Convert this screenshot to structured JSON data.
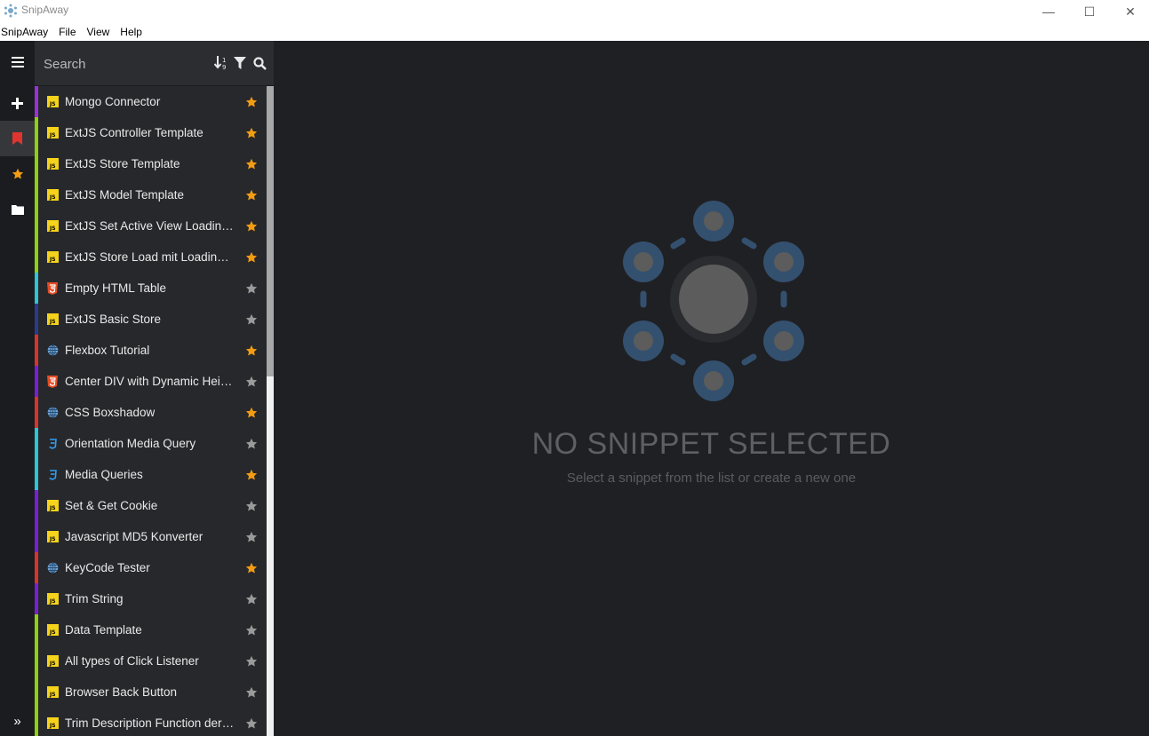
{
  "window": {
    "title": "SnipAway",
    "minimize": "—",
    "maximize": "☐",
    "close": "✕"
  },
  "menu": [
    "SnipAway",
    "File",
    "View",
    "Help"
  ],
  "rail": {
    "items": [
      "menu-icon",
      "add-icon",
      "bookmark-icon",
      "star-icon",
      "folder-icon"
    ],
    "bottom": "»"
  },
  "search": {
    "placeholder": "Search"
  },
  "colors": {
    "js": "#f5d21b",
    "favorite": "#f39c12",
    "unstarred": "#9a9a9a",
    "illustration_blue": "#34506f",
    "illustration_gray": "#5c5c5c"
  },
  "snippets": [
    {
      "name": "Mongo Connector",
      "lang": "js",
      "bar": "#9b30d9",
      "fav": true
    },
    {
      "name": "ExtJS Controller Template",
      "lang": "js",
      "bar": "#8fd10f",
      "fav": true
    },
    {
      "name": "ExtJS Store Template",
      "lang": "js",
      "bar": "#8fd10f",
      "fav": true
    },
    {
      "name": "ExtJS Model Template",
      "lang": "js",
      "bar": "#8fd10f",
      "fav": true
    },
    {
      "name": "ExtJS Set Active View Loading Mask",
      "lang": "js",
      "bar": "#8fd10f",
      "fav": true
    },
    {
      "name": "ExtJS Store Load mit Loading Mask",
      "lang": "js",
      "bar": "#8fd10f",
      "fav": true
    },
    {
      "name": "Empty HTML Table",
      "lang": "html",
      "bar": "#2ec4d6",
      "fav": false
    },
    {
      "name": "ExtJS Basic Store",
      "lang": "js",
      "bar": "#2a3b8f",
      "fav": false
    },
    {
      "name": "Flexbox Tutorial",
      "lang": "web",
      "bar": "#d8342b",
      "fav": true
    },
    {
      "name": "Center DIV with Dynamic Height",
      "lang": "html",
      "bar": "#7a1fd6",
      "fav": false
    },
    {
      "name": "CSS Boxshadow",
      "lang": "web",
      "bar": "#d8342b",
      "fav": true
    },
    {
      "name": "Orientation Media Query",
      "lang": "css",
      "bar": "#2ec4d6",
      "fav": false
    },
    {
      "name": "Media Queries",
      "lang": "css",
      "bar": "#2ec4d6",
      "fav": true
    },
    {
      "name": "Set & Get Cookie",
      "lang": "js",
      "bar": "#7a1fd6",
      "fav": false
    },
    {
      "name": "Javascript MD5 Konverter",
      "lang": "js",
      "bar": "#7a1fd6",
      "fav": false
    },
    {
      "name": "KeyCode Tester",
      "lang": "web",
      "bar": "#d8342b",
      "fav": true
    },
    {
      "name": "Trim String",
      "lang": "js",
      "bar": "#7a1fd6",
      "fav": false
    },
    {
      "name": "Data Template",
      "lang": "js",
      "bar": "#8fd10f",
      "fav": false
    },
    {
      "name": "All types of Click Listener",
      "lang": "js",
      "bar": "#8fd10f",
      "fav": false
    },
    {
      "name": "Browser Back Button",
      "lang": "js",
      "bar": "#8fd10f",
      "fav": false
    },
    {
      "name": "Trim Description Function der Cards",
      "lang": "js",
      "bar": "#8fd10f",
      "fav": false
    }
  ],
  "main": {
    "empty_title": "NO SNIPPET SELECTED",
    "empty_subtitle": "Select a snippet from the list or create a new one"
  }
}
